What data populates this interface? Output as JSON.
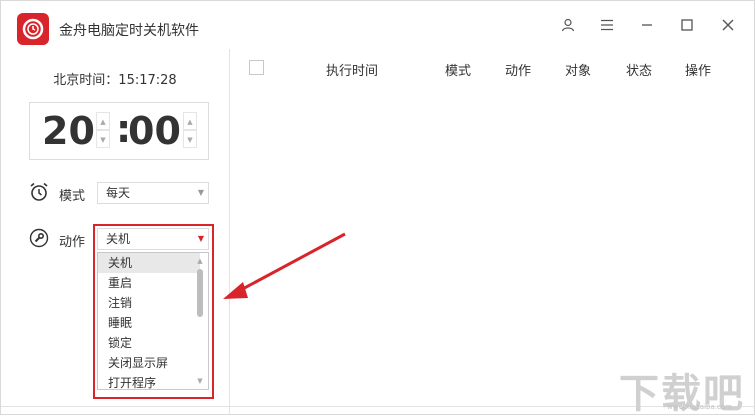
{
  "app": {
    "title": "金舟电脑定时关机软件"
  },
  "titlebar": {
    "user_icon": "user-icon",
    "menu_icon": "menu-icon",
    "minimize_icon": "minimize-icon",
    "maximize_icon": "maximize-icon",
    "close_icon": "close-icon"
  },
  "sidebar": {
    "beijing_time": "北京时间：15:17:28",
    "hour": "20",
    "separator": ":",
    "minute": "00",
    "mode": {
      "label": "模式",
      "value": "每天"
    },
    "action": {
      "label": "动作",
      "value": "关机",
      "options": [
        "关机",
        "重启",
        "注销",
        "睡眠",
        "锁定",
        "关闭显示屏",
        "打开程序"
      ]
    }
  },
  "table": {
    "headers": [
      "执行时间",
      "模式",
      "动作",
      "对象",
      "状态",
      "操作"
    ]
  },
  "watermark": {
    "text": "下载吧",
    "sub": "www.xiazaiba.com"
  },
  "colors": {
    "accent": "#d8252b",
    "border": "#dcdcdc"
  }
}
